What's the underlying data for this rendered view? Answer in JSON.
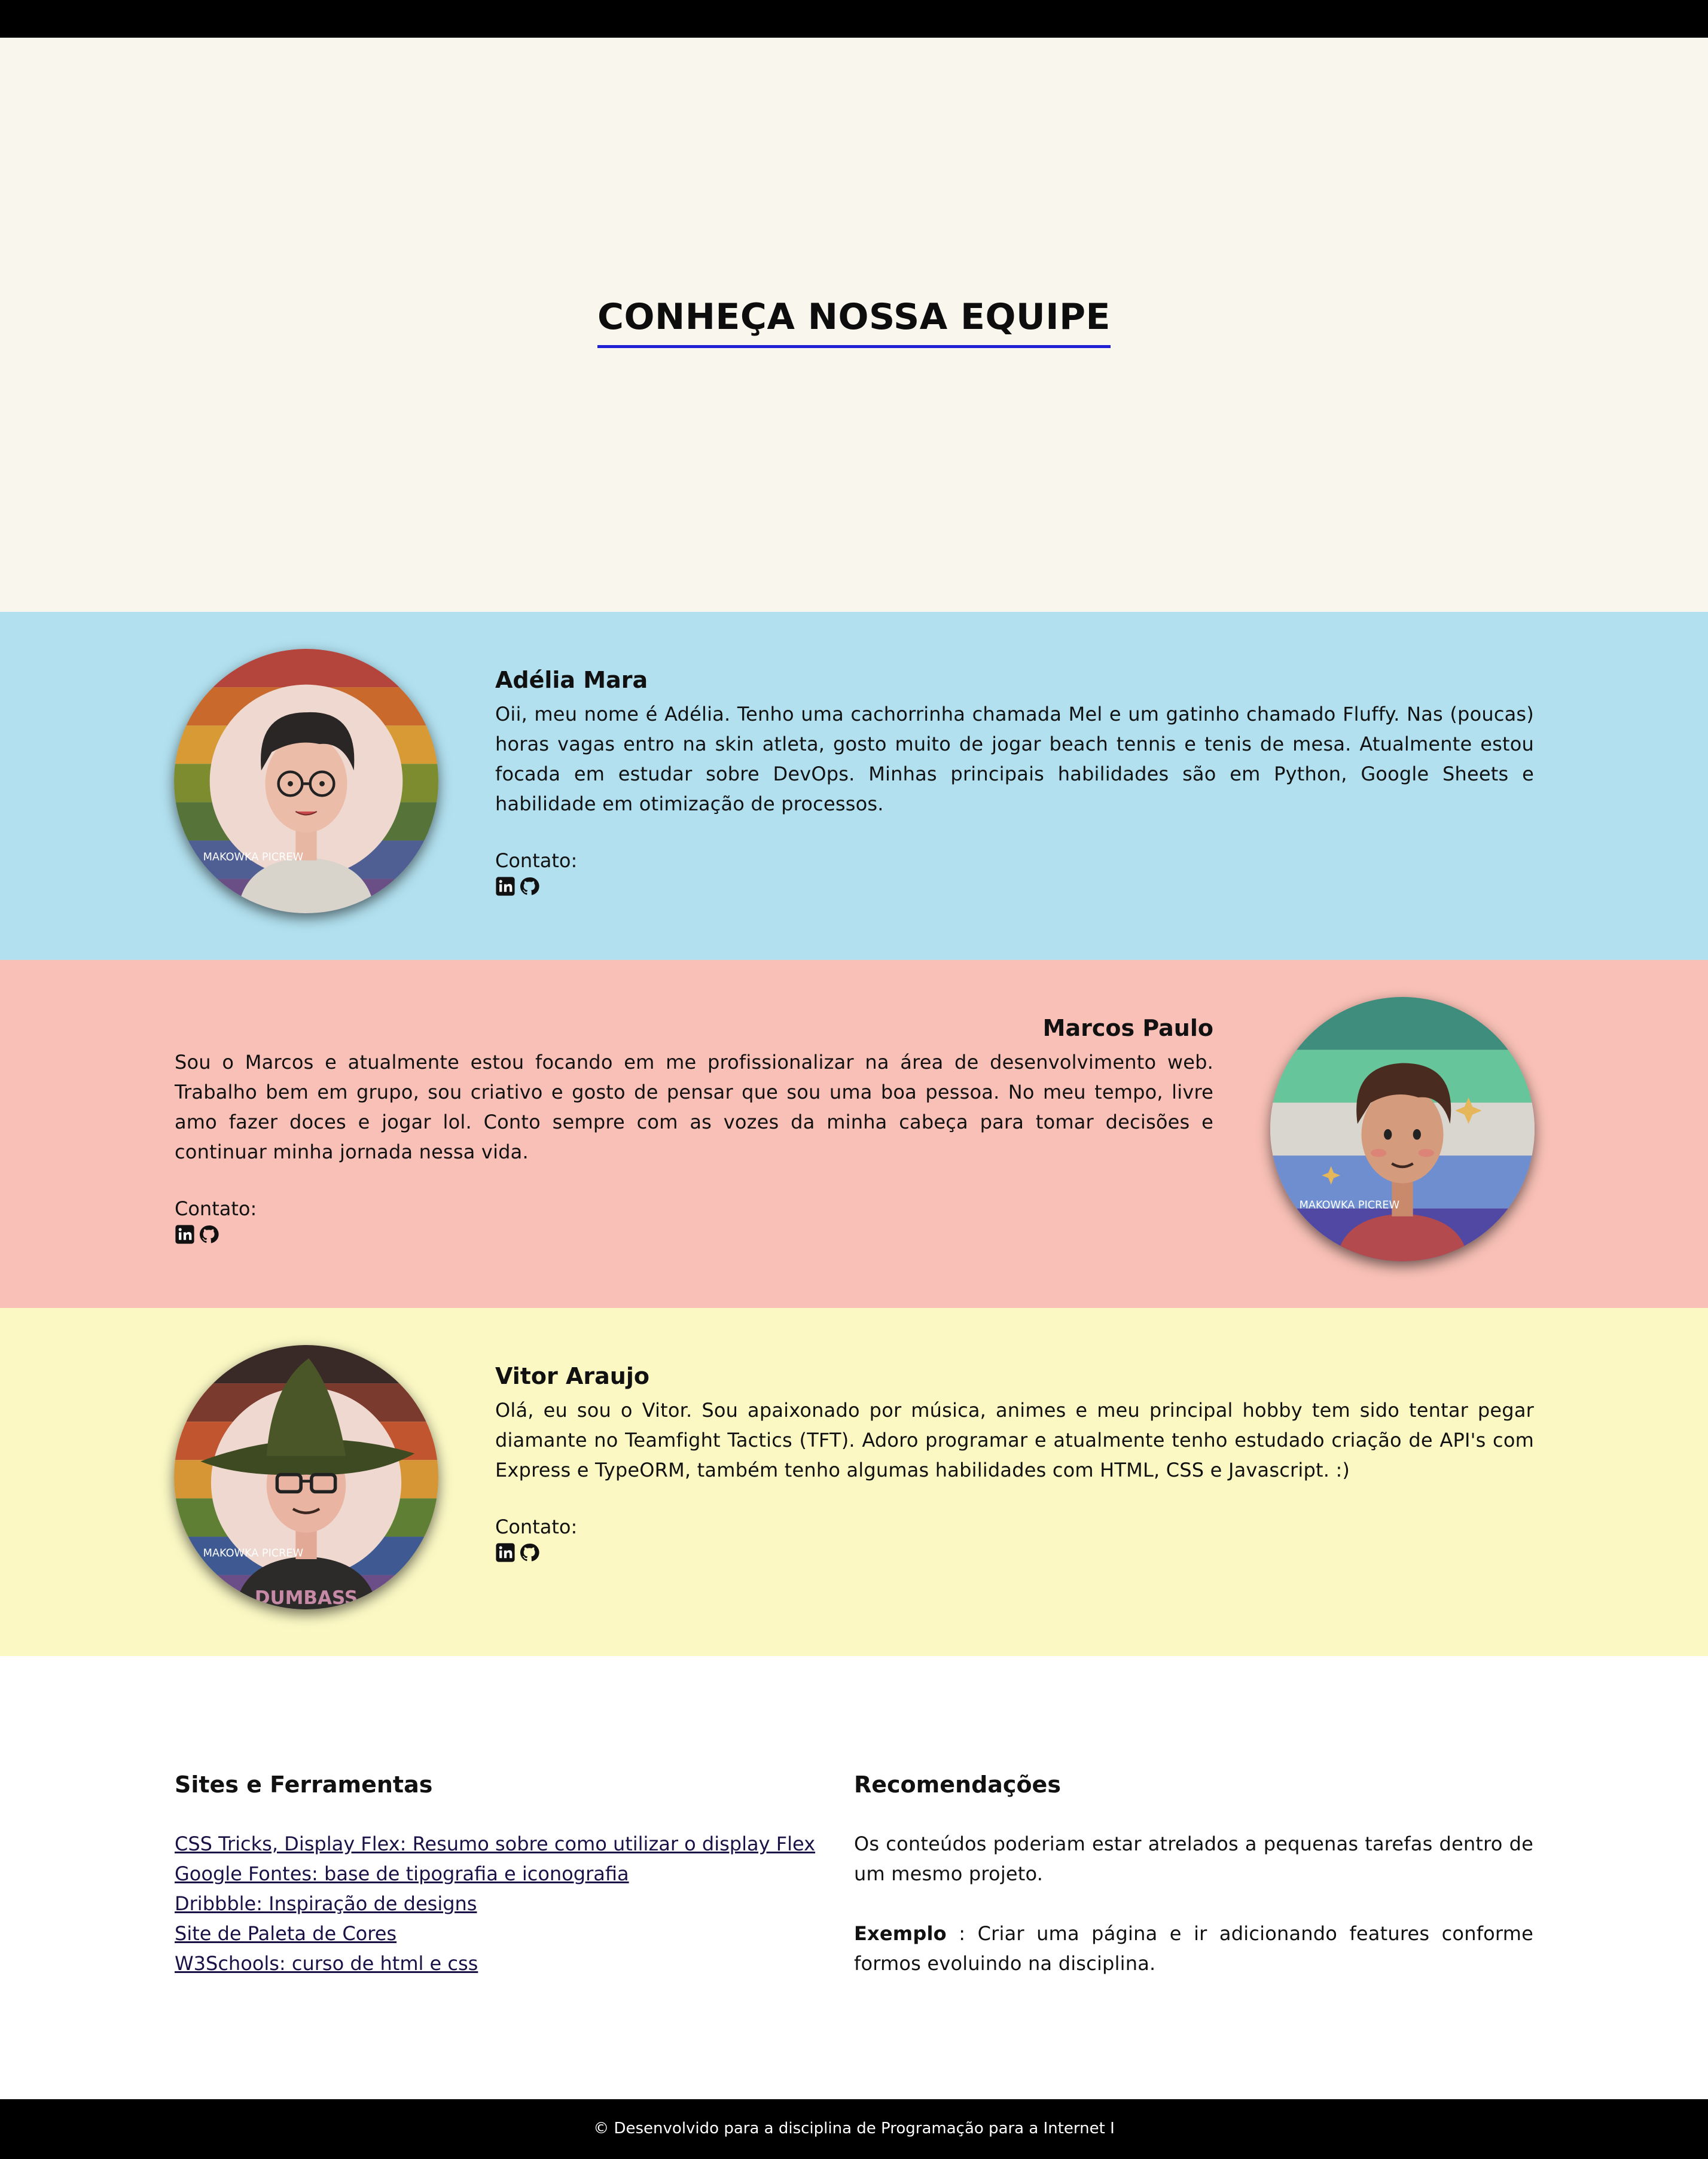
{
  "hero": {
    "title": "CONHEÇA NOSSA EQUIPE",
    "accent": "#1f1fd6"
  },
  "members": [
    {
      "name": "Adélia Mara",
      "bio": "Oii, meu nome é Adélia. Tenho uma cachorrinha chamada Mel e um gatinho chamado Fluffy. Nas (poucas) horas vagas entro na skin atleta, gosto muito de jogar beach tennis e tenis de mesa. Atualmente estou focada em estudar sobre DevOps. Minhas principais habilidades são em Python, Google Sheets e habilidade em otimização de processos.",
      "contact_label": "Contato:",
      "icons": [
        "linkedin-icon",
        "github-icon"
      ],
      "background": "#b2e0ef",
      "avatar_watermark": "MAKOWKA PICREW"
    },
    {
      "name": "Marcos Paulo",
      "bio": "Sou o Marcos e atualmente estou focando em me profissionalizar na área de desenvolvimento web. Trabalho bem em grupo, sou criativo e gosto de pensar que sou uma boa pessoa. No meu tempo, livre amo fazer doces e jogar lol. Conto sempre com as vozes da minha cabeça para tomar decisões e continuar minha jornada nessa vida.",
      "contact_label": "Contato:",
      "icons": [
        "linkedin-icon",
        "github-icon"
      ],
      "background": "#f8c0b6",
      "avatar_watermark": "MAKOWKA PICREW"
    },
    {
      "name": "Vitor Araujo",
      "bio": "Olá, eu sou o Vitor. Sou apaixonado por música, animes e meu principal hobby tem sido tentar pegar diamante no Teamfight Tactics (TFT). Adoro programar e atualmente tenho estudado criação de API's com Express e TypeORM, também tenho algumas habilidades com HTML, CSS e Javascript. :)",
      "contact_label": "Contato:",
      "icons": [
        "linkedin-icon",
        "github-icon"
      ],
      "background": "#fbf8c4",
      "avatar_watermark": "MAKOWKA PICREW",
      "shirt_text": "DUMBASS"
    }
  ],
  "resources": {
    "title": "Sites e Ferramentas",
    "links": [
      "CSS Tricks, Display Flex: Resumo sobre como utilizar o display Flex",
      "Google Fontes: base de tipografia e iconografia",
      "Dribbble: Inspiração de designs",
      "Site de Paleta de Cores",
      "W3Schools: curso de html e css"
    ]
  },
  "recommendations": {
    "title": "Recomendações",
    "paragraph": "Os conteúdos poderiam estar atrelados a pequenas tarefas dentro de um mesmo projeto.",
    "example_label": "Exemplo",
    "example_text": " : Criar uma página e ir adicionando features conforme formos evoluindo na disciplina."
  },
  "footer": {
    "text": "© Desenvolvido para a disciplina de Programação para a Internet I"
  }
}
